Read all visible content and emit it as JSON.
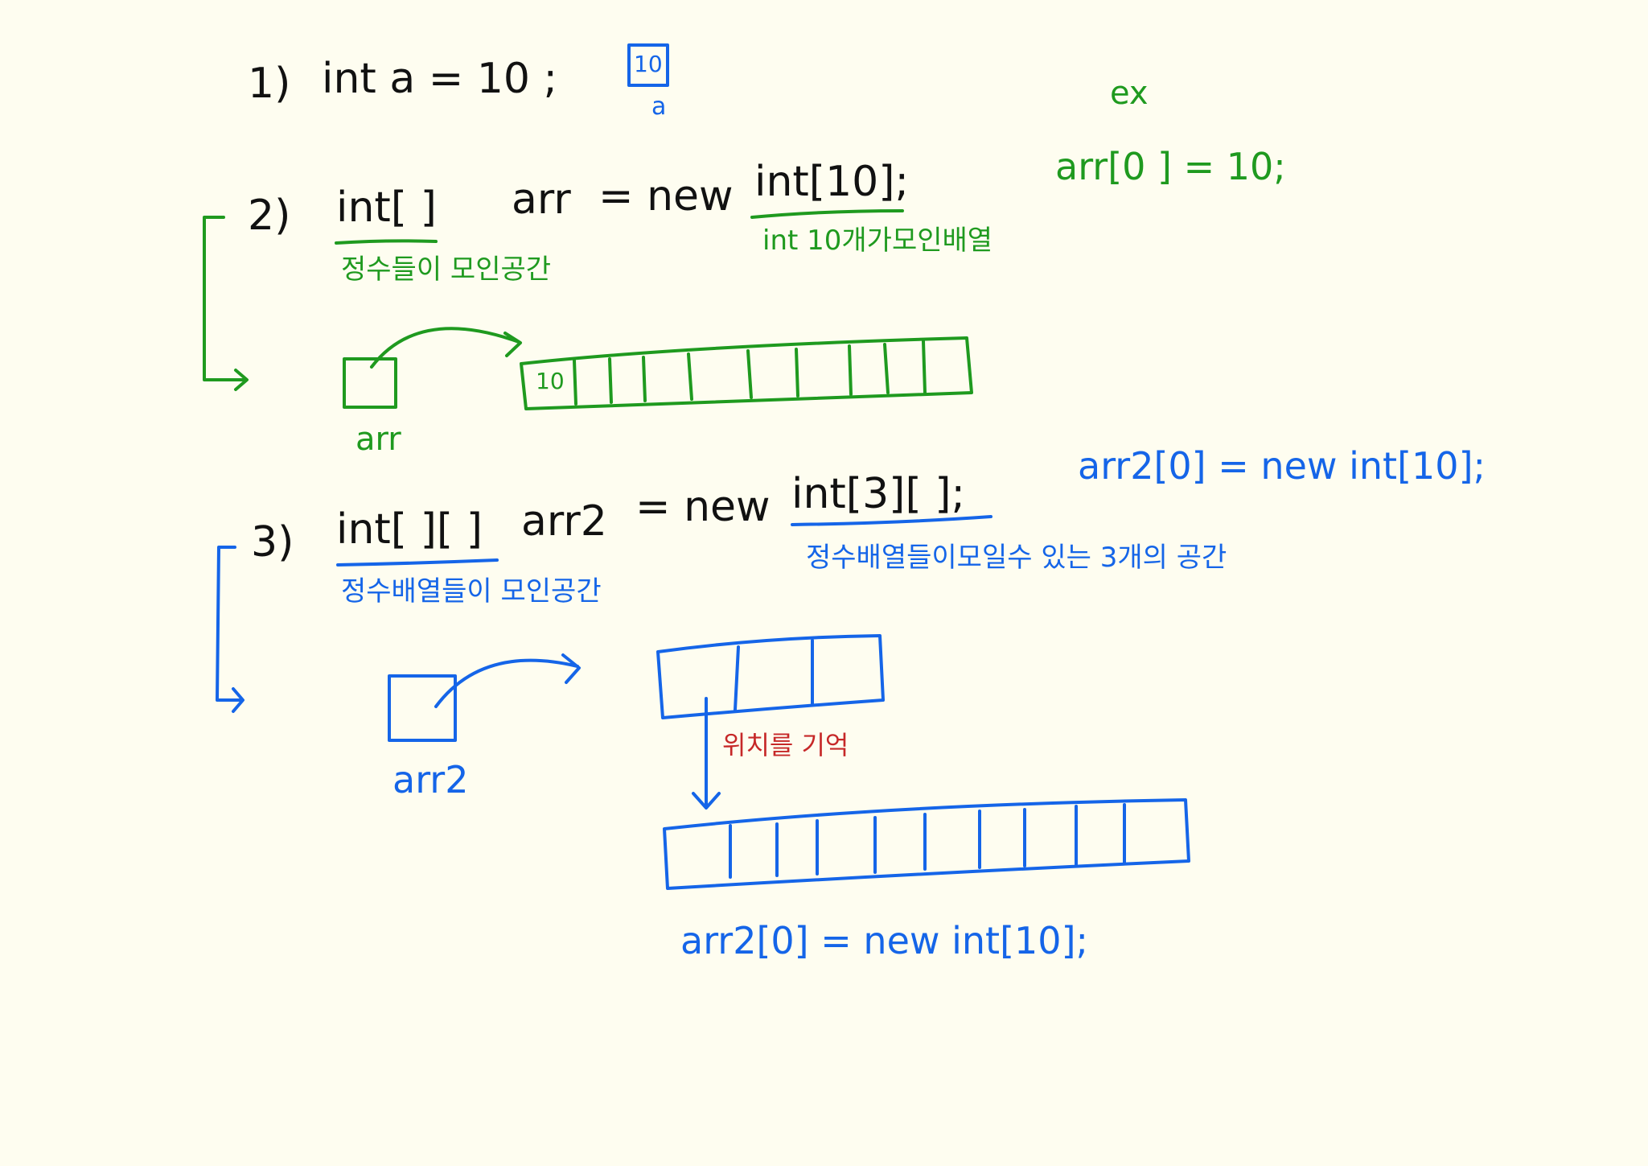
{
  "colors": {
    "black": "#111111",
    "green": "#1f9a1f",
    "blue": "#1565e8",
    "red": "#c62828",
    "paper": "#fefdf0"
  },
  "s1": {
    "num": "1)",
    "code": "int   a = 10 ;",
    "box_value": "10",
    "box_label": "a"
  },
  "ex": {
    "label": "ex",
    "code": "arr[0 ] = 10;"
  },
  "s2": {
    "num": "2)",
    "decl": "int[ ]",
    "name": "arr",
    "assign": "= new",
    "rhs": "int[10];",
    "note_left": "정수들이 모인공간",
    "note_right": "int 10개가모인배열",
    "var_label": "arr",
    "cell0": "10"
  },
  "s3": {
    "num": "3)",
    "decl": "int[ ][ ]",
    "name": "arr2",
    "assign": "= new",
    "rhs": "int[3][ ];",
    "side_code": "arr2[0] = new   int[10];",
    "note_left": "정수배열들이 모인공간",
    "note_right": "정수배열들이모일수 있는 3개의 공간",
    "var_label": "arr2",
    "memo": "위치를 기억",
    "bottom_code": "arr2[0] = new   int[10];"
  }
}
